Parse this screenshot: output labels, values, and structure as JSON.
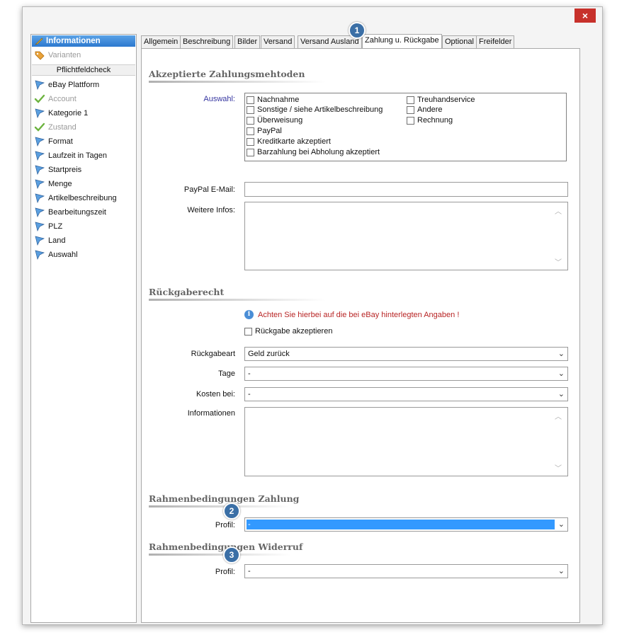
{
  "window": {
    "close_label": "×"
  },
  "sidebar": {
    "header": "Informationen",
    "variants": "Varianten",
    "check_title": "Pflichtfeldcheck",
    "items": [
      {
        "label": "eBay Plattform",
        "icon": "flag-icon",
        "ok": false
      },
      {
        "label": "Account",
        "icon": "checkmark-icon",
        "ok": true
      },
      {
        "label": "Kategorie 1",
        "icon": "flag-icon",
        "ok": false
      },
      {
        "label": "Zustand",
        "icon": "checkmark-icon",
        "ok": true
      },
      {
        "label": "Format",
        "icon": "flag-icon",
        "ok": false
      },
      {
        "label": "Laufzeit in Tagen",
        "icon": "flag-icon",
        "ok": false
      },
      {
        "label": "Startpreis",
        "icon": "flag-icon",
        "ok": false
      },
      {
        "label": "Menge",
        "icon": "flag-icon",
        "ok": false
      },
      {
        "label": "Artikelbeschreibung",
        "icon": "flag-icon",
        "ok": false
      },
      {
        "label": "Bearbeitungszeit",
        "icon": "flag-icon",
        "ok": false
      },
      {
        "label": "PLZ",
        "icon": "flag-icon",
        "ok": false
      },
      {
        "label": "Land",
        "icon": "flag-icon",
        "ok": false
      },
      {
        "label": "Auswahl",
        "icon": "flag-icon",
        "ok": false
      }
    ]
  },
  "tabs": [
    "Allgemein",
    "Beschreibung",
    "Bilder",
    "Versand",
    "Versand Ausland",
    "Zahlung u. Rückgabe",
    "Optional",
    "Freifelder"
  ],
  "active_tab": "Zahlung u. Rückgabe",
  "payment": {
    "section_title": "Akzeptierte Zahlungsmehtoden",
    "selection_label": "Auswahl:",
    "methods_left": [
      "Nachnahme",
      "Sonstige / siehe Artikelbeschreibung",
      "Überweisung",
      "PayPal",
      "Kreditkarte akzeptiert",
      "Barzahlung bei Abholung akzeptiert"
    ],
    "methods_right": [
      "Treuhandservice",
      "Andere",
      "Rechnung"
    ],
    "paypal_label": "PayPal E-Mail:",
    "paypal_value": "",
    "more_info_label": "Weitere Infos:"
  },
  "returns": {
    "section_title": "Rückgaberecht",
    "notice": "Achten Sie hierbei auf die bei eBay hinterlegten Angaben !",
    "accept_label": "Rückgabe akzeptieren",
    "type_label": "Rückgabeart",
    "type_value": "Geld zurück",
    "days_label": "Tage",
    "days_value": "-",
    "cost_label": "Kosten bei:",
    "cost_value": "-",
    "info_label": "Informationen"
  },
  "payment_policy": {
    "section_title": "Rahmenbedingungen Zahlung",
    "profile_label": "Profil:",
    "profile_value": "-"
  },
  "return_policy": {
    "section_title": "Rahmenbedingungen Widerruf",
    "profile_label": "Profil:",
    "profile_value": "-"
  },
  "badges": [
    "1",
    "2",
    "3"
  ],
  "colors": {
    "accent": "#2c78cf",
    "selection": "#3399ff",
    "close": "#c7312b",
    "warning": "#b82525",
    "badge": "#3b6fa6"
  }
}
